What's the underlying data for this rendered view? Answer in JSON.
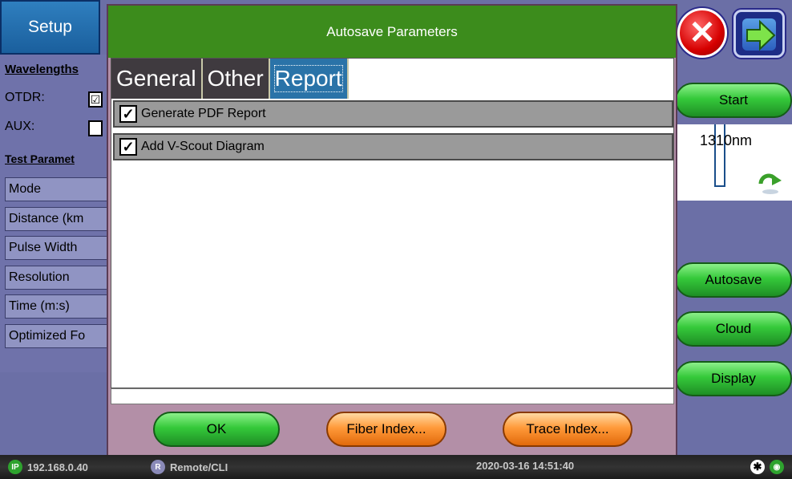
{
  "setup_tab": {
    "label": "Setup"
  },
  "left_panel": {
    "wavelengths_header": "Wavelengths",
    "otdr_label": "OTDR:",
    "aux_label": "AUX:",
    "test_params_header": "Test Paramet",
    "rows": [
      "Mode",
      "Distance (km",
      "Pulse Width",
      "Resolution",
      "Time (m:s)",
      "Optimized Fo"
    ]
  },
  "dialog": {
    "title": "Autosave Parameters",
    "tabs": [
      {
        "label": "General",
        "active": false
      },
      {
        "label": "Other",
        "active": false
      },
      {
        "label": "Report",
        "active": true
      }
    ],
    "options": [
      {
        "label": "Generate PDF Report",
        "checked": true
      },
      {
        "label": "Add V-Scout Diagram",
        "checked": true
      }
    ],
    "buttons": {
      "ok": "OK",
      "fiber_index": "Fiber Index...",
      "trace_index": "Trace Index..."
    }
  },
  "right_panel": {
    "start": "Start",
    "wavelength": "1310nm",
    "autosave": "Autosave",
    "cloud": "Cloud",
    "display": "Display"
  },
  "statusbar": {
    "ip_badge": "IP",
    "ip": "192.168.0.40",
    "remote_badge": "R",
    "remote": "Remote/CLI",
    "datetime": "2020-03-16  14:51:40"
  },
  "colors": {
    "dialog_title_bg": "#3c8c1c",
    "active_tab": "#2a73a8",
    "green_button": "#35c93a",
    "orange_button": "#ff9a3a"
  }
}
